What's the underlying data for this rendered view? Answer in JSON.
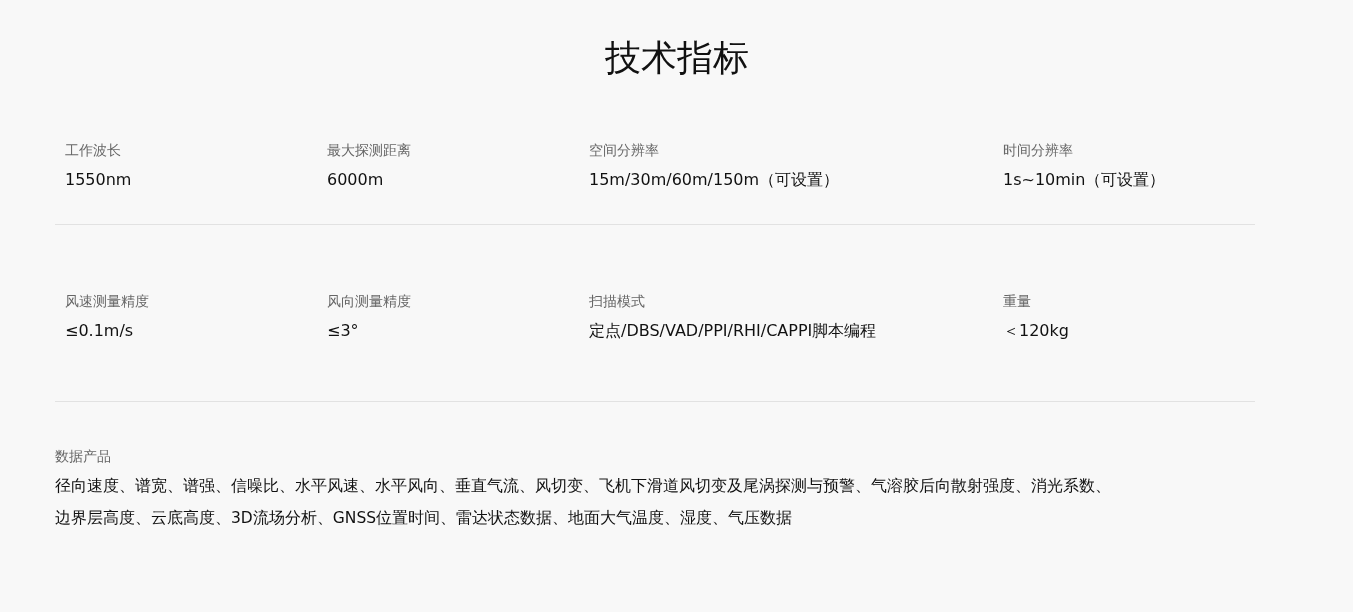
{
  "title": "技术指标",
  "spec_rows": [
    [
      {
        "label": "工作波长",
        "value": "1550nm"
      },
      {
        "label": "最大探测距离",
        "value": "6000m"
      },
      {
        "label": "空间分辨率",
        "value": "15m/30m/60m/150m（可设置）"
      },
      {
        "label": "时间分辨率",
        "value": "1s~10min（可设置）"
      }
    ],
    [
      {
        "label": "风速测量精度",
        "value": "≤0.1m/s"
      },
      {
        "label": "风向测量精度",
        "value": "≤3°"
      },
      {
        "label": "扫描模式",
        "value": "定点/DBS/VAD/PPI/RHI/CAPPI脚本编程"
      },
      {
        "label": "重量",
        "value": "＜120kg"
      }
    ]
  ],
  "data_products": {
    "label": "数据产品",
    "lines": [
      "径向速度、谱宽、谱强、信噪比、水平风速、水平风向、垂直气流、风切变、飞机下滑道风切变及尾涡探测与预警、气溶胶后向散射强度、消光系数、",
      "边界层高度、云底高度、3D流场分析、GNSS位置时间、雷达状态数据、地面大气温度、湿度、气压数据"
    ]
  }
}
